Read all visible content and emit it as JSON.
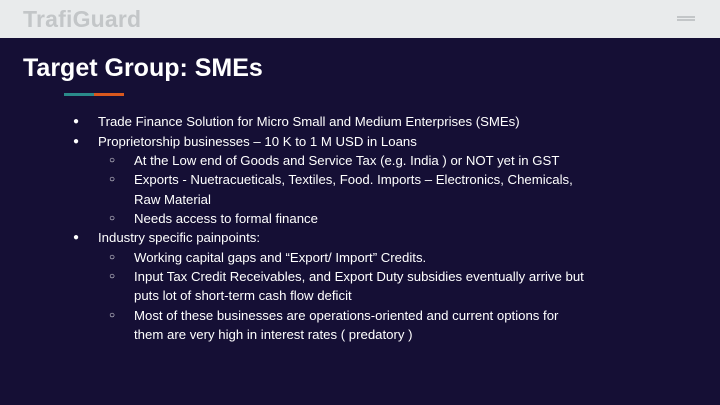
{
  "brand": "TrafiGuard",
  "title": "Target Group: SMEs",
  "colors": {
    "background": "#150f35",
    "header": "#e9ebec",
    "accent_teal": "#2a8a8a",
    "accent_orange": "#d9581e"
  },
  "icons": {
    "menu": "hamburger-icon"
  },
  "bullets": {
    "level1_symbol": "●",
    "level2_symbol": "○"
  },
  "content": {
    "item1": "Trade Finance Solution for Micro Small and Medium Enterprises  (SMEs)",
    "item2": "Proprietorship businesses –  10 K to 1 M USD in Loans",
    "item2_sub1": "At the Low end of Goods and Service Tax (e.g. India ) or NOT yet in GST",
    "item2_sub2_l1": "Exports - Nuetracueticals, Textiles, Food. Imports – Electronics, Chemicals,",
    "item2_sub2_l2": "Raw Material",
    "item2_sub3": "Needs access to formal finance",
    "item3": "Industry specific painpoints:",
    "item3_sub1": "Working capital gaps and “Export/ Import” Credits.",
    "item3_sub2_l1": "Input Tax Credit Receivables, and Export Duty subsidies eventually arrive but",
    "item3_sub2_l2": "puts lot of short-term cash flow deficit",
    "item3_sub3_l1": "Most of these businesses are operations-oriented and current options for",
    "item3_sub3_l2": "them are very high in interest rates ( predatory )"
  }
}
